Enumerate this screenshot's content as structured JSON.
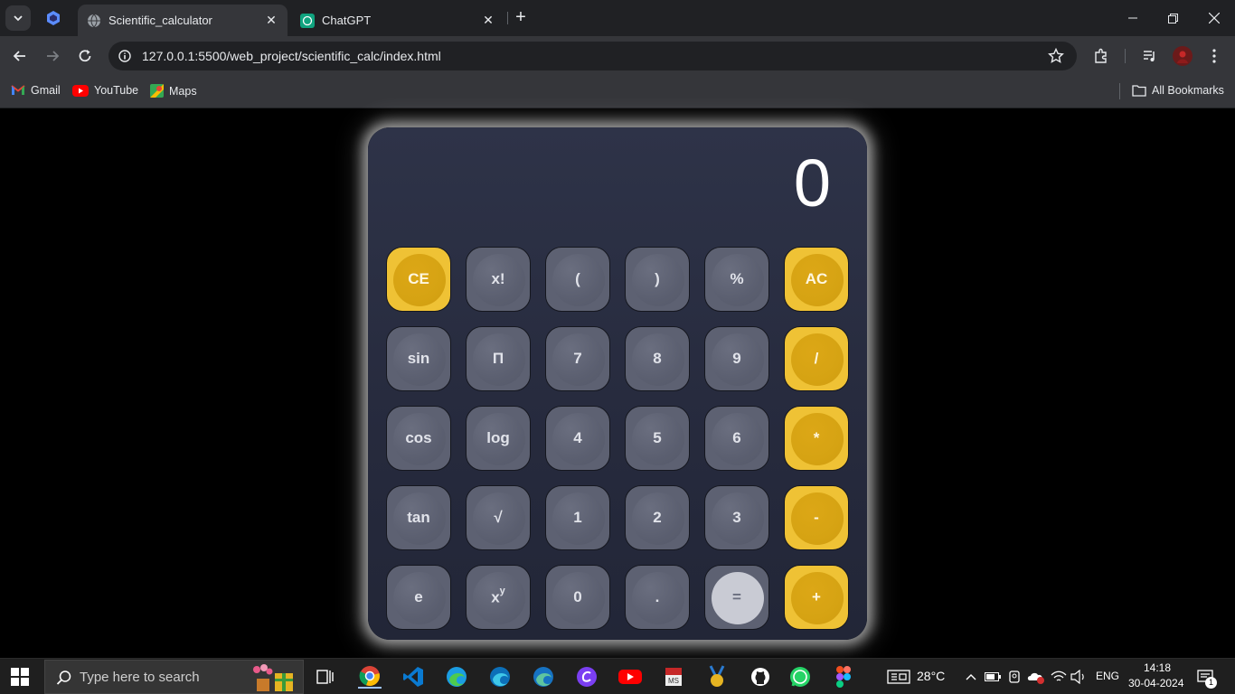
{
  "browser": {
    "tabs": [
      {
        "title": "Scientific_calculator",
        "active": true
      },
      {
        "title": "ChatGPT",
        "active": false
      }
    ],
    "url": "127.0.0.1:5500/web_project/scientific_calc/index.html",
    "bookmarks": [
      "Gmail",
      "YouTube",
      "Maps"
    ],
    "all_bookmarks_label": "All Bookmarks"
  },
  "calculator": {
    "display": "0",
    "rows": [
      [
        {
          "label": "CE",
          "style": "yellow"
        },
        {
          "label": "x!",
          "style": "gray"
        },
        {
          "label": "(",
          "style": "gray"
        },
        {
          "label": ")",
          "style": "gray"
        },
        {
          "label": "%",
          "style": "gray"
        },
        {
          "label": "AC",
          "style": "yellow"
        }
      ],
      [
        {
          "label": "sin",
          "style": "gray"
        },
        {
          "label": "Π",
          "style": "gray"
        },
        {
          "label": "7",
          "style": "gray"
        },
        {
          "label": "8",
          "style": "gray"
        },
        {
          "label": "9",
          "style": "gray"
        },
        {
          "label": "/",
          "style": "yellow"
        }
      ],
      [
        {
          "label": "cos",
          "style": "gray"
        },
        {
          "label": "log",
          "style": "gray"
        },
        {
          "label": "4",
          "style": "gray"
        },
        {
          "label": "5",
          "style": "gray"
        },
        {
          "label": "6",
          "style": "gray"
        },
        {
          "label": "*",
          "style": "yellow"
        }
      ],
      [
        {
          "label": "tan",
          "style": "gray"
        },
        {
          "label": "√",
          "style": "gray"
        },
        {
          "label": "1",
          "style": "gray"
        },
        {
          "label": "2",
          "style": "gray"
        },
        {
          "label": "3",
          "style": "gray"
        },
        {
          "label": "-",
          "style": "yellow"
        }
      ],
      [
        {
          "label": "e",
          "style": "gray"
        },
        {
          "label": "x",
          "sup": "y",
          "style": "gray"
        },
        {
          "label": "0",
          "style": "gray"
        },
        {
          "label": ".",
          "style": "gray"
        },
        {
          "label": "=",
          "style": "equals"
        },
        {
          "label": "+",
          "style": "yellow"
        }
      ]
    ],
    "colors": {
      "yellow": "#efc235",
      "gray": "#5d6172",
      "equals": "#c9cbd4"
    }
  },
  "taskbar": {
    "search_placeholder": "Type here to search",
    "temperature": "28°C",
    "language": "ENG",
    "time": "14:18",
    "date": "30-04-2024",
    "notification_count": "1"
  }
}
